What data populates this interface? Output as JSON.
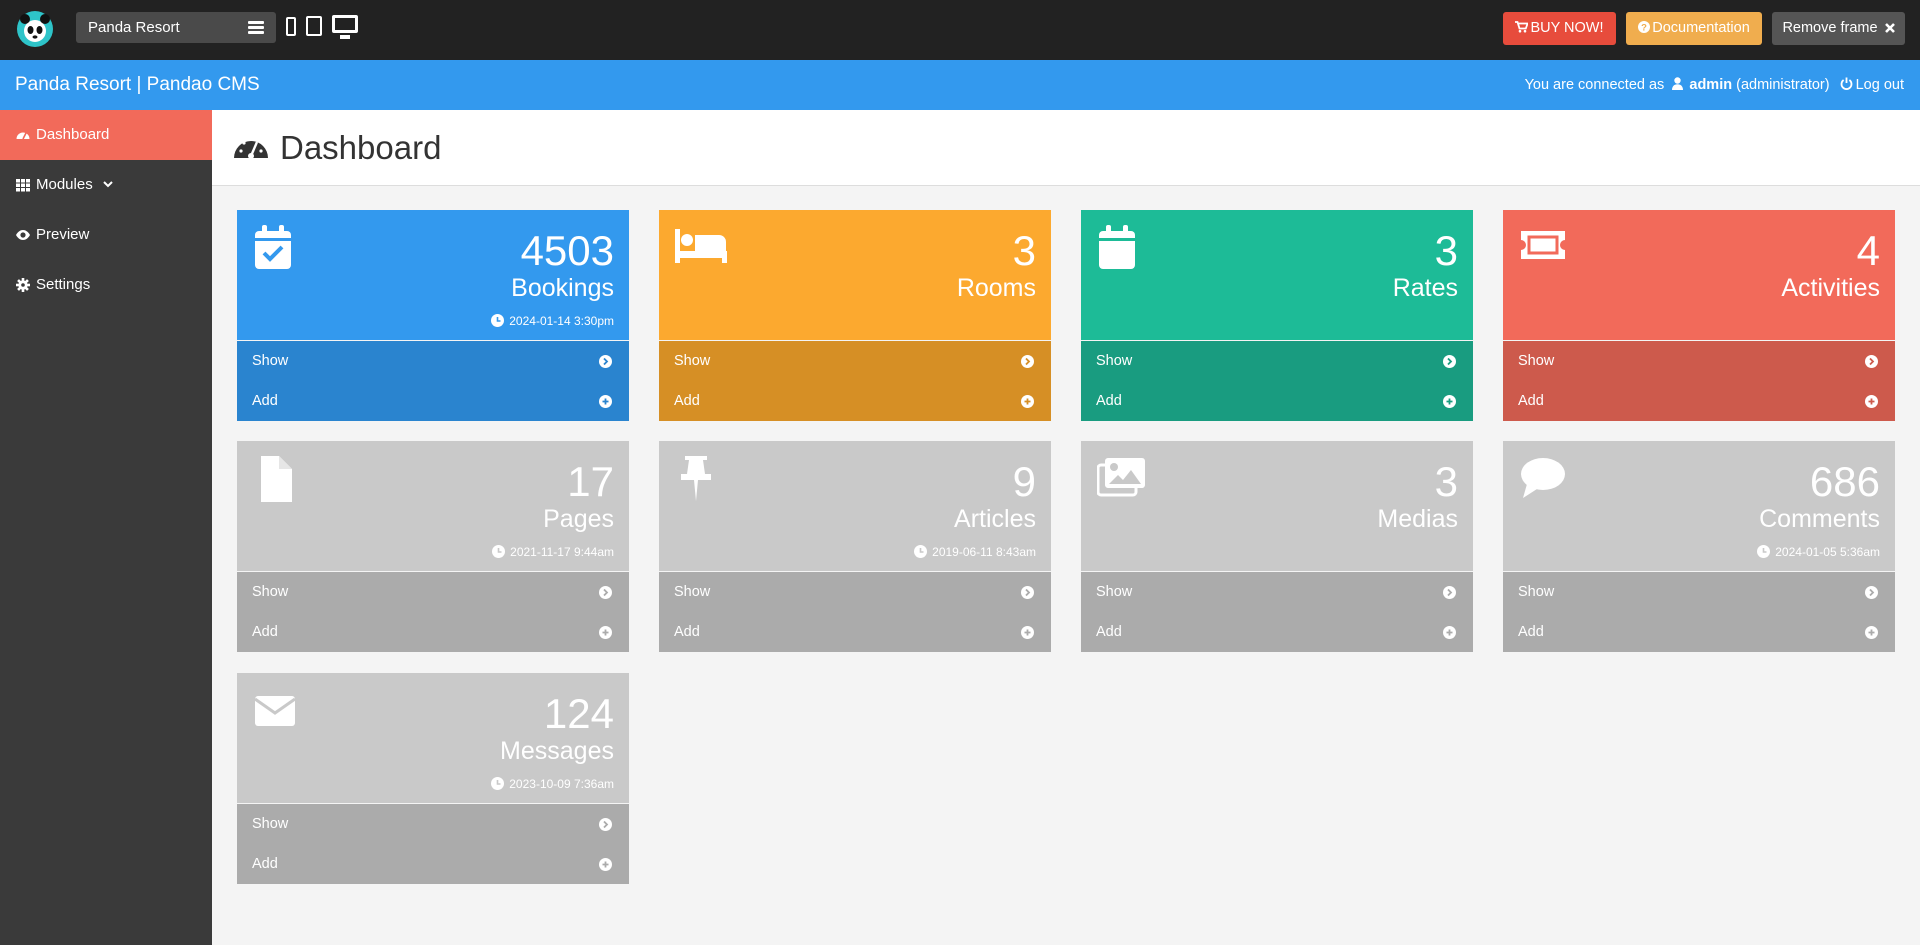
{
  "topbar": {
    "site_select": "Panda Resort",
    "buy_label": "BUY NOW!",
    "doc_label": "Documentation",
    "remove_label": "Remove frame",
    "icons": [
      "panda-logo",
      "menu-icon",
      "phone-icon",
      "tablet-icon",
      "desktop-icon",
      "cart-icon",
      "question-icon",
      "close-icon"
    ]
  },
  "header": {
    "brand": "Panda Resort | Pandao CMS",
    "connected_text": "You are connected as",
    "username": "admin",
    "role": "(administrator)",
    "logout": "Log out"
  },
  "sidebar": {
    "items": [
      {
        "label": "Dashboard",
        "icon": "gauge-icon",
        "active": true
      },
      {
        "label": "Modules",
        "icon": "grid-icon"
      },
      {
        "label": "Preview",
        "icon": "eye-icon"
      },
      {
        "label": "Settings",
        "icon": "gear-icon"
      }
    ]
  },
  "page": {
    "title": "Dashboard"
  },
  "tiles": [
    {
      "count": "4503",
      "label": "Bookings",
      "date": "2024-01-14 3:30pm",
      "show": "Show",
      "add": "Add",
      "icon": "calendar-check-icon",
      "color": "#3399ee"
    },
    {
      "count": "3",
      "label": "Rooms",
      "show": "Show",
      "add": "Add",
      "icon": "bed-icon",
      "color": "#fca92f"
    },
    {
      "count": "3",
      "label": "Rates",
      "show": "Show",
      "add": "Add",
      "icon": "calendar-icon",
      "color": "#1dbb97"
    },
    {
      "count": "4",
      "label": "Activities",
      "show": "Show",
      "add": "Add",
      "icon": "ticket-icon",
      "color": "#f26a5a"
    },
    {
      "count": "17",
      "label": "Pages",
      "date": "2021-11-17 9:44am",
      "show": "Show",
      "add": "Add",
      "icon": "file-icon",
      "color": "#c9c9c9"
    },
    {
      "count": "9",
      "label": "Articles",
      "date": "2019-06-11 8:43am",
      "show": "Show",
      "add": "Add",
      "icon": "pin-icon",
      "color": "#c9c9c9"
    },
    {
      "count": "3",
      "label": "Medias",
      "show": "Show",
      "add": "Add",
      "icon": "images-icon",
      "color": "#c9c9c9"
    },
    {
      "count": "686",
      "label": "Comments",
      "date": "2024-01-05 5:36am",
      "show": "Show",
      "add": "Add",
      "icon": "comment-icon",
      "color": "#c9c9c9"
    },
    {
      "count": "124",
      "label": "Messages",
      "date": "2023-10-09 7:36am",
      "show": "Show",
      "add": "Add",
      "icon": "envelope-icon",
      "color": "#c9c9c9"
    }
  ]
}
